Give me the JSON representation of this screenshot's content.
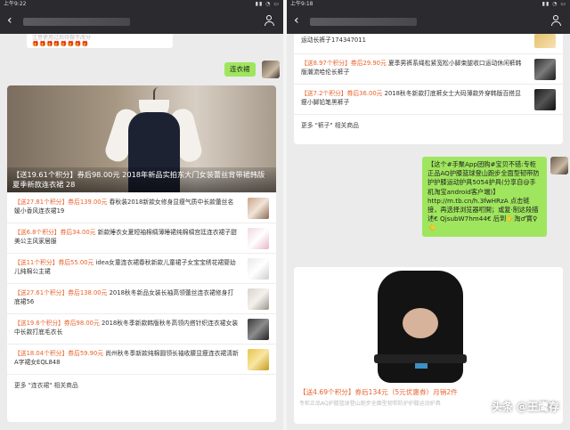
{
  "left": {
    "status_time": "上午9:22",
    "notice_line1": "注意使用过后待做不改分",
    "gifts": "🎁🎁🎁🎁🎁🎁🎁🎁",
    "user_message": "连衣裙",
    "hero_caption": "【送19.61个积分】券后98.00元 2018年新品实拍东大门女装蕾丝背带裙韩版夏季新款连衣裙 28",
    "items": [
      {
        "reward": "【送27.81个积分】",
        "price": "券后139.00元",
        "title": "春秋装2018新款女修身显瘦气质中长款蕾丝名媛小香风连衣裙19"
      },
      {
        "reward": "【送6.8个积分】",
        "price": "券后34.00元",
        "title": "新款睡衣女夏短袖棉绸薄睡裙纯棉绸宫廷连衣裙子甜美公主风家居服"
      },
      {
        "reward": "【送11个积分】",
        "price": "券后55.00元",
        "title": "idea女童连衣裙春秋新款儿童裙子女宝宝绣花裙婴幼儿纯棉公主裙"
      },
      {
        "reward": "【送27.61个积分】",
        "price": "券后138.00元",
        "title": "2018秋冬新品女装长袖高领蕾丝连衣裙修身打底裙56"
      },
      {
        "reward": "【送19.6个积分】",
        "price": "券后98.00元",
        "title": "2018秋冬季新款韩版秋冬高领内搭针织连衣裙女装中长款打底毛衣长"
      },
      {
        "reward": "【送18.04个积分】",
        "price": "券后59.90元",
        "title": "尚州秋冬季新款纯棉圆领长袖收腰显瘦连衣裙清新A字裙女EQL848"
      }
    ],
    "more": "更多 \"连衣裙\" 相关商品"
  },
  "right": {
    "status_time": "上午9:18",
    "top_item": "运动长裤子174347011",
    "items": [
      {
        "reward": "【送8.97个积分】",
        "price": "券后29.90元",
        "title": "夏季男裤系绳松紧宽松小脚束腿收口运动休闲裤韩版潮流哈伦长裤子"
      },
      {
        "reward": "【送7.2个积分】",
        "price": "券后36.00元",
        "title": "2018秋冬新款打底裤女士大码薄款外穿韩版百搭显瘦小脚铅笔黑裤子"
      }
    ],
    "more": "更多 \"裤子\" 相关商品",
    "user_message": "【这个#手聚App团购#宝贝不错:专柜正品AQ护膝篮球登山跑步全面型韧带防护护膝运动护具5054护具(分享自@手机淘宝android客户端)】http://m.tb.cn/h.3fwHRzA 点击链接，再选择浏览器咑開；或复·制这段描述€ QjsubW7hm44€ 后到👉淘♂寳♀👈",
    "product_caption": "【送4.69个积分】券后134元（5元优惠券）月销2件",
    "product_sub": "专柜正品AQ护膝篮球登山跑步全面型韧带防护护膝运动护具",
    "watermark": "头条 @王鹰存"
  }
}
